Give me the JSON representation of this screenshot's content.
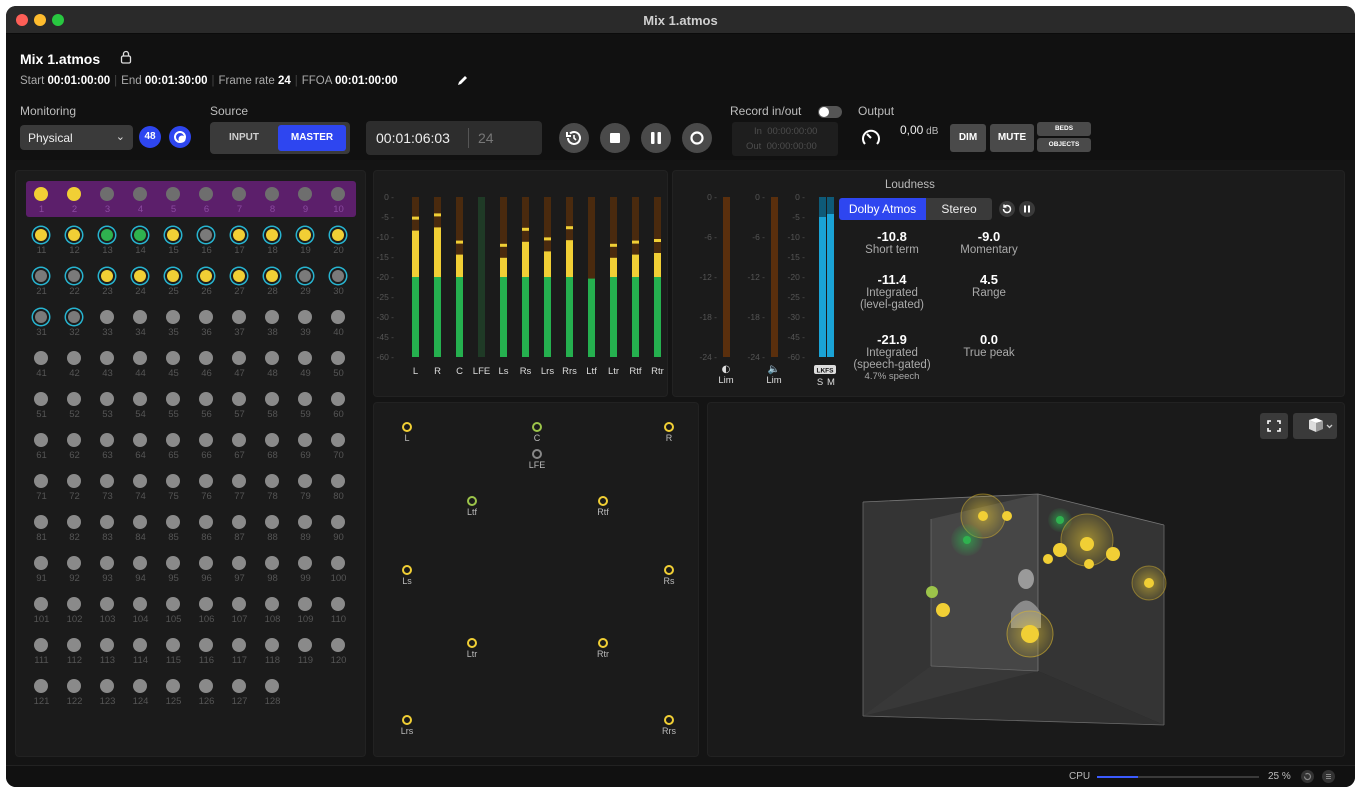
{
  "window": {
    "title": "Mix 1.atmos"
  },
  "header": {
    "doc_name": "Mix 1.atmos",
    "start_label": "Start",
    "start": "00:01:00:00",
    "end_label": "End",
    "end": "00:01:30:00",
    "framerate_label": "Frame rate",
    "framerate": "24",
    "ffoa_label": "FFOA",
    "ffoa": "00:01:00:00"
  },
  "monitoring": {
    "label": "Monitoring",
    "value": "Physical",
    "channels_badge": "48"
  },
  "source": {
    "label": "Source",
    "input": "INPUT",
    "master": "MASTER"
  },
  "timecode": {
    "value": "00:01:06:03",
    "frame_rate": "24"
  },
  "record": {
    "label": "Record in/out",
    "in_label": "In",
    "in": "00:00:00:00",
    "out_label": "Out",
    "out": "00:00:00:00"
  },
  "output": {
    "label": "Output",
    "level": "0,00",
    "unit": "dB",
    "dim": "DIM",
    "mute": "MUTE",
    "beds": "BEDS",
    "objects": "OBJECTS"
  },
  "meters": {
    "scale": [
      "0",
      "-5",
      "-10",
      "-15",
      "-20",
      "-25",
      "-30",
      "-45",
      "-60"
    ],
    "lim_scale": [
      "0",
      "-6",
      "-12",
      "-18",
      "-24"
    ],
    "lkfs_scale": [
      "0",
      "-5",
      "-10",
      "-15",
      "-20",
      "-25",
      "-30",
      "-45",
      "-60"
    ],
    "channel_labels": [
      "L",
      "R",
      "C",
      "LFE",
      "Ls",
      "Rs",
      "Lrs",
      "Rrs",
      "Ltf",
      "Ltr",
      "Rtf",
      "Rtr"
    ],
    "levels": [
      0.79,
      0.81,
      0.64,
      0,
      0.62,
      0.72,
      0.66,
      0.73,
      0.49,
      0.62,
      0.64,
      0.65
    ],
    "lim_label": "Lim",
    "lkfs_badge": "LKFS",
    "s_label": "S",
    "m_label": "M"
  },
  "loudness": {
    "title": "Loudness",
    "tab_atmos": "Dolby Atmos",
    "tab_stereo": "Stereo",
    "short_term": "-10.8",
    "short_term_label": "Short term",
    "momentary": "-9.0",
    "momentary_label": "Momentary",
    "integrated_lg": "-11.4",
    "integrated_lg_label": "Integrated",
    "integrated_lg_sub": "(level-gated)",
    "range": "4.5",
    "range_label": "Range",
    "integrated_sg": "-21.9",
    "integrated_sg_label": "Integrated",
    "integrated_sg_sub": "(speech-gated)",
    "speech": "4.7% speech",
    "true_peak": "0.0",
    "true_peak_label": "True peak"
  },
  "speakers": [
    "L",
    "C",
    "R",
    "LFE",
    "Ltf",
    "Rtf",
    "Ls",
    "Rs",
    "Ltr",
    "Rtr",
    "Lrs",
    "Rrs"
  ],
  "channel_count": 128,
  "status": {
    "cpu_label": "CPU",
    "cpu_value": "25 %",
    "cpu_fraction": 0.25
  },
  "colors": {
    "accent": "#2e46f0",
    "yellow": "#f1cf35",
    "green": "#2fb24f",
    "teal_ring": "#27b4d0",
    "purple": "#5c1f6b",
    "meter_green": "#25b04f",
    "meter_dark_orange": "#5a2f0d"
  }
}
